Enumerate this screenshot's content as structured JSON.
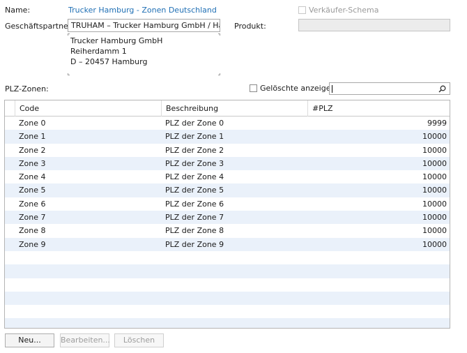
{
  "header": {
    "name_label": "Name:",
    "name_value": "Trucker Hamburg - Zonen Deutschland",
    "vendor_schema_label": "Verkäufer-Schema",
    "partner_label": "Geschäftspartner:",
    "partner_value": "TRUHAM – Trucker Hamburg GmbH / Hamburg",
    "product_label": "Produkt:",
    "product_value": "",
    "address": [
      "Trucker Hamburg GmbH",
      "Reiherdamm 1",
      "D – 20457 Hamburg"
    ]
  },
  "zones": {
    "label": "PLZ-Zonen:",
    "show_deleted_label": "Gelöschte anzeigen",
    "search_value": "",
    "columns": [
      "Code",
      "Beschreibung",
      "#PLZ"
    ],
    "rows": [
      {
        "code": "Zone 0",
        "desc": "PLZ der Zone 0",
        "count": "9999"
      },
      {
        "code": "Zone 1",
        "desc": "PLZ der Zone 1",
        "count": "10000"
      },
      {
        "code": "Zone 2",
        "desc": "PLZ der Zone 2",
        "count": "10000"
      },
      {
        "code": "Zone 3",
        "desc": "PLZ der Zone 3",
        "count": "10000"
      },
      {
        "code": "Zone 4",
        "desc": "PLZ der Zone 4",
        "count": "10000"
      },
      {
        "code": "Zone 5",
        "desc": "PLZ der Zone 5",
        "count": "10000"
      },
      {
        "code": "Zone 6",
        "desc": "PLZ der Zone 6",
        "count": "10000"
      },
      {
        "code": "Zone 7",
        "desc": "PLZ der Zone 7",
        "count": "10000"
      },
      {
        "code": "Zone 8",
        "desc": "PLZ der Zone 8",
        "count": "10000"
      },
      {
        "code": "Zone 9",
        "desc": "PLZ der Zone 9",
        "count": "10000"
      }
    ]
  },
  "buttons": {
    "new": "Neu...",
    "edit": "Bearbeiten...",
    "delete": "Löschen"
  },
  "icons": {
    "search": "search-icon"
  },
  "colors": {
    "name_value": "#1f6fb4",
    "row_alt": "#eaf1fa"
  }
}
